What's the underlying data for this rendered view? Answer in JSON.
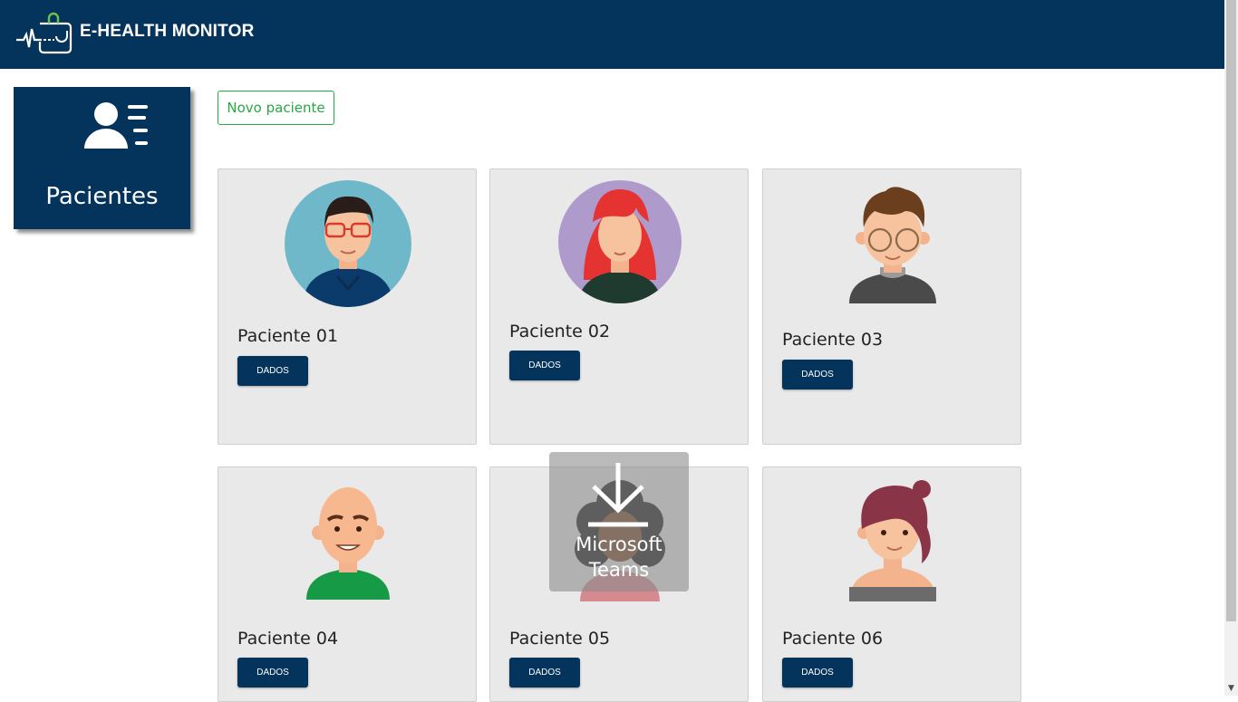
{
  "header": {
    "app_name": "E-HEALTH MONITOR",
    "logo_icon": "health-monitor-logo-icon",
    "background_color": "#04335c"
  },
  "sidebar": {
    "tile_label": "Pacientes",
    "tile_icon": "patients-list-icon"
  },
  "main": {
    "new_patient_button": "Novo paciente",
    "accent_color": "#28a745",
    "patients": [
      {
        "name": "Paciente 01",
        "button": "DADOS",
        "avatar": "man-glasses-avatar"
      },
      {
        "name": "Paciente 02",
        "button": "DADOS",
        "avatar": "woman-red-hair-avatar"
      },
      {
        "name": "Paciente 03",
        "button": "DADOS",
        "avatar": "man-curly-glasses-avatar"
      },
      {
        "name": "Paciente 04",
        "button": "DADOS",
        "avatar": "bald-man-avatar"
      },
      {
        "name": "Paciente 05",
        "button": "DADOS",
        "avatar": "woman-curly-hair-avatar"
      },
      {
        "name": "Paciente 06",
        "button": "DADOS",
        "avatar": "woman-bun-avatar"
      }
    ]
  },
  "overlay": {
    "label_line1": "Microsoft",
    "label_line2": "Teams",
    "icon": "download-arrow-icon"
  }
}
